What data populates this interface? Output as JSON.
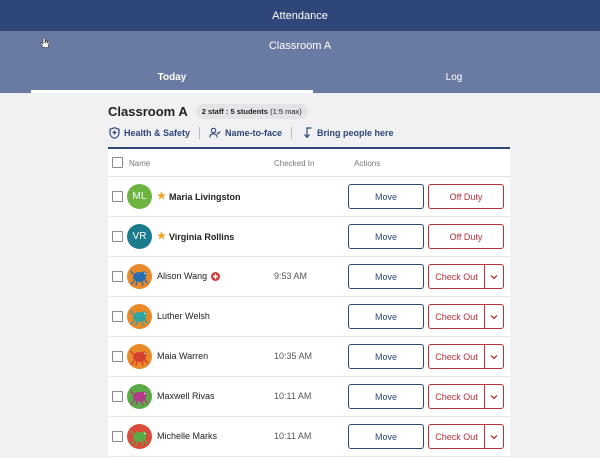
{
  "app": {
    "title": "Attendance"
  },
  "room": {
    "name": "Classroom A"
  },
  "tabs": [
    {
      "label": "Today"
    },
    {
      "label": "Log"
    }
  ],
  "header": {
    "title": "Classroom A",
    "ratio_bold": "2 staff : 5 students",
    "ratio_rest": " (1:5 max)"
  },
  "actions": [
    {
      "label": "Health & Safety",
      "icon": "shield-icon"
    },
    {
      "label": "Name-to-face",
      "icon": "person-check-icon"
    },
    {
      "label": "Bring people here",
      "icon": "arrow-down-left-icon"
    }
  ],
  "table": {
    "col_name": "Name",
    "col_checked_in": "Checked In",
    "col_actions": "Actions"
  },
  "staff": [
    {
      "initials": "ML",
      "name": "Maria Livingston",
      "color": "#6cb33f",
      "move": "Move",
      "action": "Off Duty"
    },
    {
      "initials": "VR",
      "name": "Virginia Rollins",
      "color": "#1b7a8c",
      "move": "Move",
      "action": "Off Duty"
    }
  ],
  "students": [
    {
      "name": "Alison Wang",
      "time": "9:53 AM",
      "bg": "#e8892a",
      "fg": "#2b6fb0",
      "alert": true,
      "move": "Move",
      "action": "Check Out"
    },
    {
      "name": "Luther Welsh",
      "time": "",
      "bg": "#e8892a",
      "fg": "#2fa5a0",
      "alert": false,
      "move": "Move",
      "action": "Check Out"
    },
    {
      "name": "Maia Warren",
      "time": "10:35 AM",
      "bg": "#e8892a",
      "fg": "#d6402e",
      "alert": false,
      "move": "Move",
      "action": "Check Out"
    },
    {
      "name": "Maxwell Rivas",
      "time": "10:11 AM",
      "bg": "#5aab46",
      "fg": "#b33b8a",
      "alert": false,
      "move": "Move",
      "action": "Check Out"
    },
    {
      "name": "Michelle Marks",
      "time": "10:11 AM",
      "bg": "#d94b3a",
      "fg": "#5aab46",
      "alert": false,
      "move": "Move",
      "action": "Check Out"
    }
  ],
  "colors": {
    "primary": "#2e4678",
    "secondary": "#6a7ba3",
    "danger": "#b8323a"
  }
}
